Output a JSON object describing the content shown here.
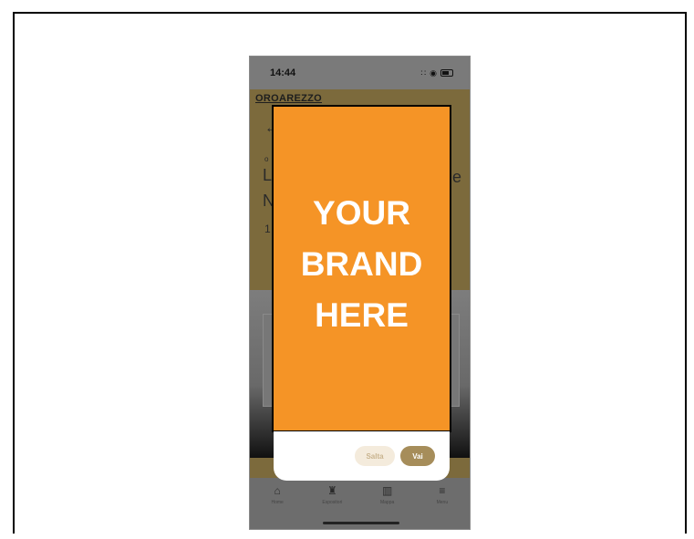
{
  "status_bar": {
    "time": "14:44",
    "signal": "∷",
    "wifi": "◉"
  },
  "app": {
    "logo": "OROAREZZO",
    "back_arrow": "←",
    "bg_fragments": [
      "o",
      "L",
      "e",
      "N",
      "1"
    ]
  },
  "modal": {
    "brand_text": "YOUR\nBRAND\nHERE",
    "skip_label": "Salta",
    "go_label": "Vai"
  },
  "tabbar": {
    "items": [
      {
        "label": "Home",
        "icon": "⌂"
      },
      {
        "label": "Espositori",
        "icon": "♜"
      },
      {
        "label": "Mappa",
        "icon": "▥"
      },
      {
        "label": "Menu",
        "icon": "≡"
      }
    ]
  },
  "colors": {
    "brand_orange": "#f59426",
    "accent_gold": "#a68d5a",
    "skip_bg": "#f4ebdc"
  }
}
